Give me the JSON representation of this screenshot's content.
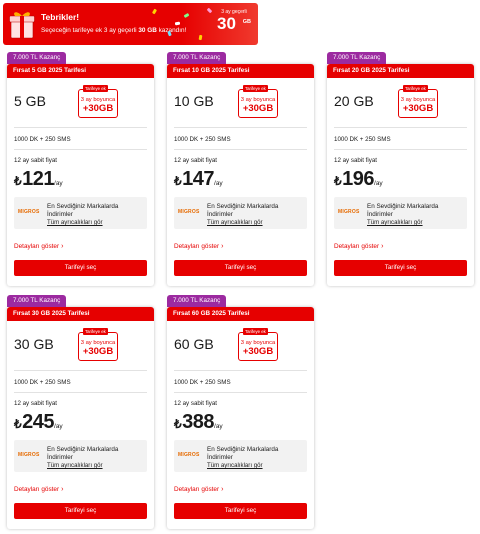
{
  "banner": {
    "title": "Tebrikler!",
    "subtitle_pre": "Seçeceğin tarifeye ek 3 ay geçerli ",
    "subtitle_bold": "30 GB",
    "subtitle_post": " kazandın!",
    "badge_small": "3 ay geçerli",
    "badge_big": "30",
    "badge_unit": "GB"
  },
  "colors": {
    "brand_red": "#e60000",
    "ribbon_purple": "#9c2aa0",
    "promo_bg": "#f2f2f2",
    "migros_orange": "#e66a00"
  },
  "common": {
    "ribbon": "7.000 TL Kazanç",
    "bonus_tag": "Tarifeye ek",
    "bonus_months": "3 ay boyunca",
    "bonus_plus": "+30GB",
    "minutes": "1000 DK + 250 SMS",
    "fixed_price": "12 ay sabit fiyat",
    "currency": "₺",
    "per_month": "/ay",
    "promo_logo": "MIGROS",
    "promo_title": "En Sevdiğiniz Markalarda İndirimler",
    "promo_link": "Tüm ayrıcalıkları gör",
    "details": "Detayları göster",
    "cta": "Tarifeyi seç"
  },
  "plans": [
    {
      "name": "Fırsat 5 GB 2025 Tarifesi",
      "data": "5 GB",
      "price": "121"
    },
    {
      "name": "Fırsat 10 GB 2025 Tarifesi",
      "data": "10 GB",
      "price": "147"
    },
    {
      "name": "Fırsat 20 GB 2025 Tarifesi",
      "data": "20 GB",
      "price": "196"
    },
    {
      "name": "Fırsat 30 GB 2025 Tarifesi",
      "data": "30 GB",
      "price": "245"
    },
    {
      "name": "Fırsat 60 GB 2025 Tarifesi",
      "data": "60 GB",
      "price": "388"
    }
  ]
}
